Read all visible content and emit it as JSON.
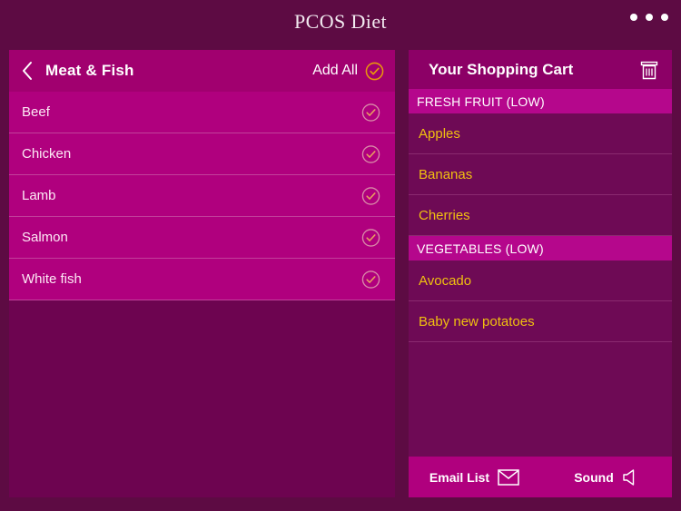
{
  "app": {
    "title": "PCOS Diet",
    "background_color": "#5d0b43",
    "accent_gold": "#f0c010",
    "accent_magenta": "#b0007e"
  },
  "topbar": {
    "overflow_menu_label": "•••"
  },
  "category_panel": {
    "back_label": "",
    "title": "Meat & Fish",
    "add_all_label": "Add All",
    "items": [
      {
        "label": "Beef"
      },
      {
        "label": "Chicken"
      },
      {
        "label": "Lamb"
      },
      {
        "label": "Salmon"
      },
      {
        "label": "White fish"
      }
    ]
  },
  "cart_panel": {
    "title": "Your Shopping Cart",
    "clear_icon": "trash-icon",
    "sections": [
      {
        "heading": "FRESH FRUIT (LOW)",
        "items": [
          {
            "label": "Apples"
          },
          {
            "label": "Bananas"
          },
          {
            "label": "Cherries"
          }
        ]
      },
      {
        "heading": "VEGETABLES (LOW)",
        "items": [
          {
            "label": "Avocado"
          },
          {
            "label": "Baby new potatoes"
          }
        ]
      }
    ],
    "footer": {
      "email_label": "Email List",
      "email_icon": "envelope-icon",
      "sound_label": "Sound",
      "sound_icon": "speaker-muted-icon"
    }
  }
}
